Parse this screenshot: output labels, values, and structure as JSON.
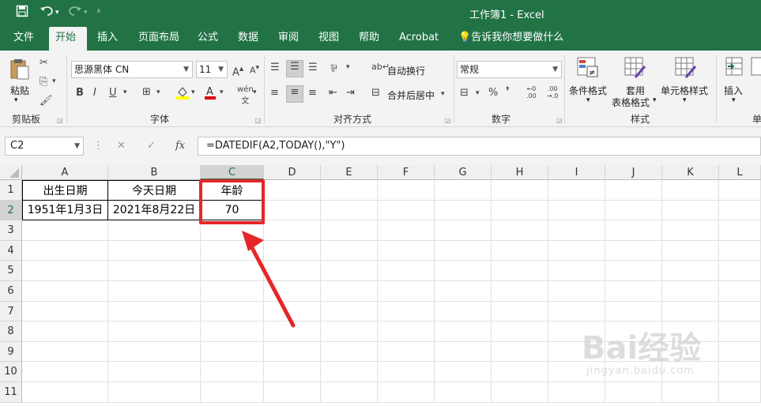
{
  "window": {
    "title": "工作簿1  -  Excel"
  },
  "quick_access": {
    "save_icon": "save-icon",
    "undo_icon": "undo-icon",
    "redo_icon": "redo-icon",
    "customize_icon": "customize-icon"
  },
  "tabs": [
    "文件",
    "开始",
    "插入",
    "页面布局",
    "公式",
    "数据",
    "审阅",
    "视图",
    "帮助",
    "Acrobat"
  ],
  "tell_me": "告诉我你想要做什么",
  "ribbon": {
    "clipboard": {
      "paste": "粘贴",
      "label": "剪贴板"
    },
    "font": {
      "name": "思源黑体 CN",
      "size": "11",
      "bold": "B",
      "italic": "I",
      "underline": "U",
      "label": "字体"
    },
    "alignment": {
      "wrap": "自动换行",
      "merge": "合并后居中",
      "label": "对齐方式"
    },
    "number": {
      "format": "常规",
      "percent": "%",
      "label": "数字"
    },
    "styles": {
      "conditional": "条件格式",
      "table_line1": "套用",
      "table_line2": "表格格式",
      "cell_styles": "单元格样式",
      "label": "样式"
    },
    "cells": {
      "insert": "插入",
      "label_partial": "单"
    }
  },
  "formula_bar": {
    "name_box": "C2",
    "formula": "=DATEDIF(A2,TODAY(),\"Y\")",
    "fx": "fx"
  },
  "columns": [
    "A",
    "B",
    "C",
    "D",
    "E",
    "F",
    "G",
    "H",
    "I",
    "J",
    "K",
    "L"
  ],
  "rows": [
    "1",
    "2",
    "3",
    "4",
    "5",
    "6",
    "7",
    "8",
    "9",
    "10",
    "11"
  ],
  "cells": {
    "A1": "出生日期",
    "B1": "今天日期",
    "C1": "年龄",
    "A2": "1951年1月3日",
    "B2": "2021年8月22日",
    "C2": "70"
  },
  "watermark": {
    "brand": "Bai经验",
    "url": "jingyan.baidu.com"
  },
  "colors": {
    "excel_green": "#217346",
    "highlight_red": "#e5262b"
  }
}
